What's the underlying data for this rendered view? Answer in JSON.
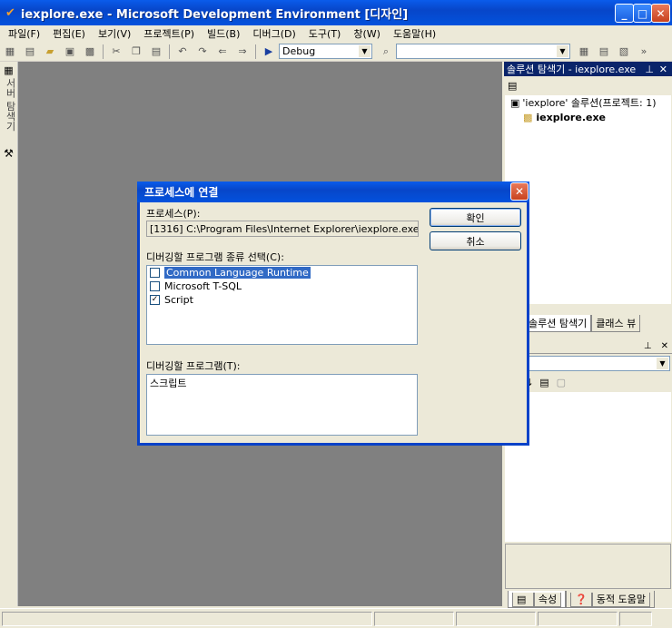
{
  "window": {
    "title": "iexplore.exe - Microsoft Development Environment [디자인]"
  },
  "menu": [
    "파일(F)",
    "편집(E)",
    "보기(V)",
    "프로젝트(P)",
    "빌드(B)",
    "디버그(D)",
    "도구(T)",
    "창(W)",
    "도움말(H)"
  ],
  "toolbar": {
    "config_value": "Debug"
  },
  "left_tabs": {
    "server_explorer": "서버 탐색기"
  },
  "solution_explorer": {
    "title": "솔루션 탐색기 - iexplore.exe",
    "solution_node": "'iexplore' 솔루션(프로젝트: 1)",
    "project_node": "iexplore.exe",
    "tab_solution": "솔루션 탐색기",
    "tab_class": "클래스 뷰"
  },
  "properties_panel": {
    "tab_properties": "속성",
    "tab_dynamic_help": "동적 도움말"
  },
  "dialog": {
    "title": "프로세스에 연결",
    "process_label": "프로세스(P):",
    "process_value": "[1316] C:\\Program Files\\Internet Explorer\\iexplore.exe",
    "program_types_label": "디버깅할 프로그램 종류 선택(C):",
    "program_types": [
      {
        "label": "Common Language Runtime",
        "checked": false,
        "selected": true
      },
      {
        "label": "Microsoft T-SQL",
        "checked": false,
        "selected": false
      },
      {
        "label": "Script",
        "checked": true,
        "selected": false
      }
    ],
    "programs_label": "디버깅할 프로그램(T):",
    "programs_value": "스크립트",
    "ok_label": "확인",
    "cancel_label": "취소"
  },
  "colors": {
    "title_blue": "#0A5CEB",
    "selection": "#316AC5",
    "editor_bg": "#808080"
  }
}
